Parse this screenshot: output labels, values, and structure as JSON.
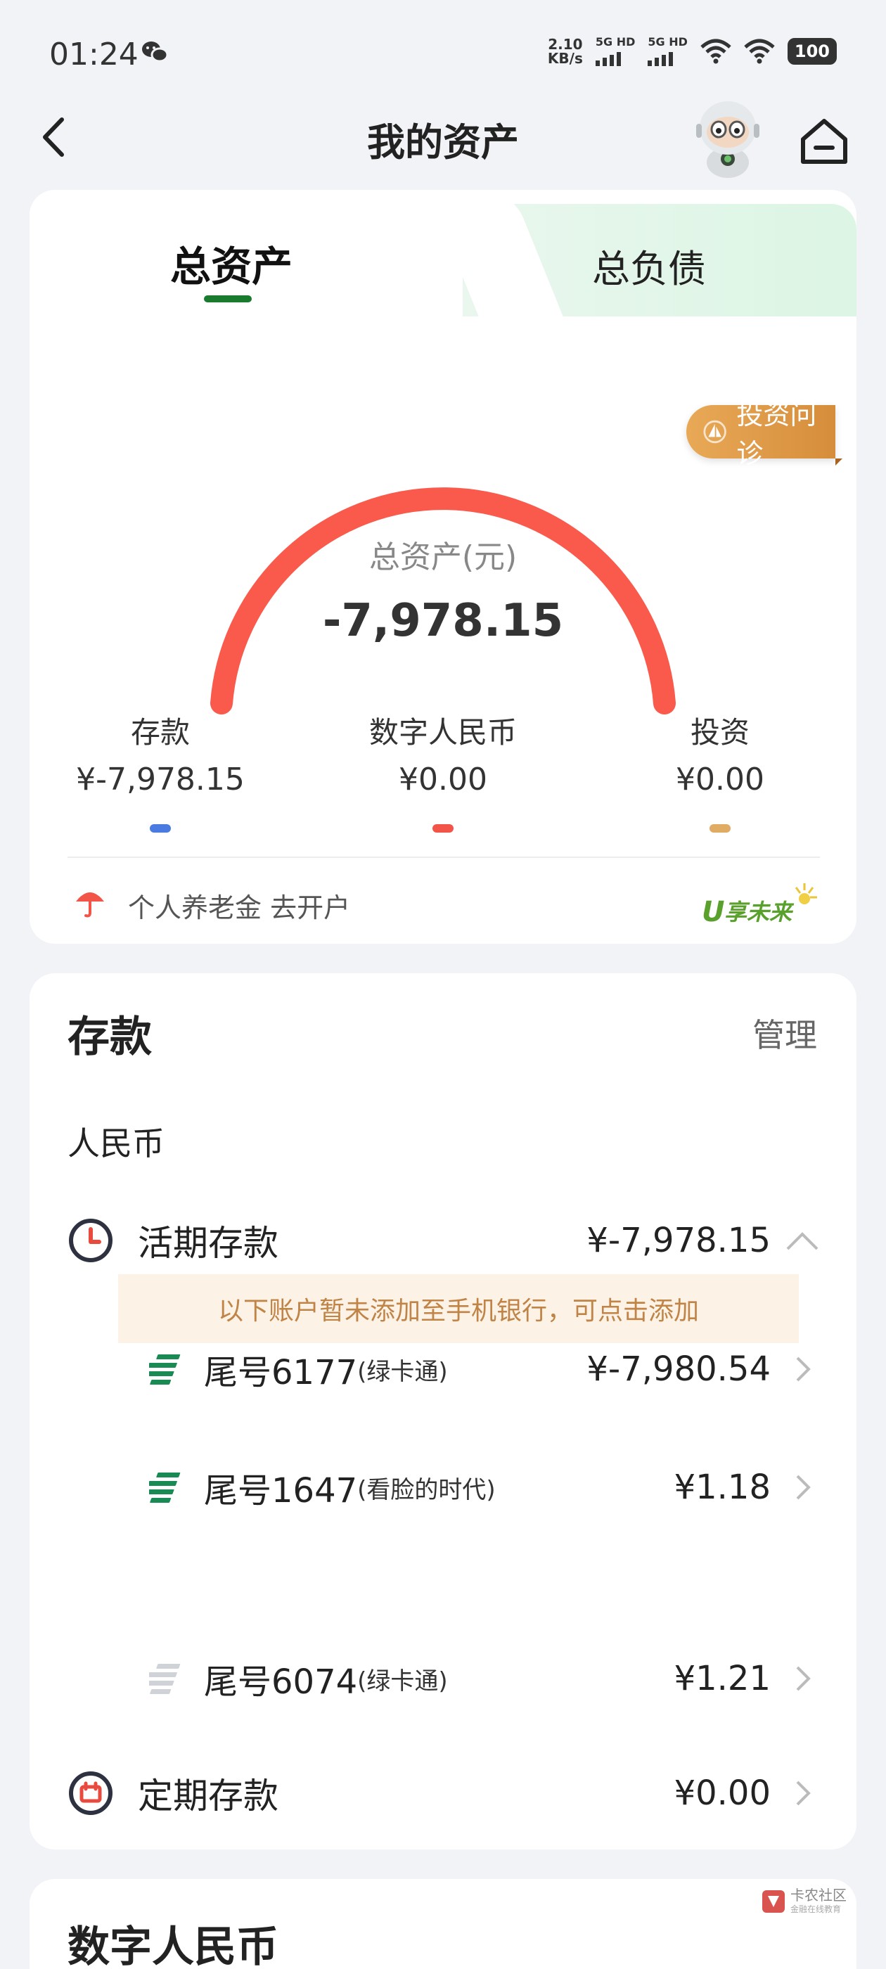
{
  "status_bar": {
    "time": "01:24",
    "net_speed_value": "2.10",
    "net_speed_unit": "KB/s",
    "signal1_label": "5G HD",
    "signal2_label": "5G HD",
    "battery": "100"
  },
  "header": {
    "title": "我的资产"
  },
  "tabs": {
    "assets": "总资产",
    "liabilities": "总负债"
  },
  "invest_badge": "投资问诊",
  "gauge": {
    "label": "总资产(元)",
    "value": "-7,978.15",
    "color": "#fa5a4b"
  },
  "categories": [
    {
      "name": "存款",
      "value": "¥-7,978.15",
      "color": "#4a7be0"
    },
    {
      "name": "数字人民币",
      "value": "¥0.00",
      "color": "#f25448"
    },
    {
      "name": "投资",
      "value": "¥0.00",
      "color": "#e0ab63"
    }
  ],
  "pension_link": "个人养老金 去开户",
  "logo_text": "U享未来",
  "deposit": {
    "title": "存款",
    "manage": "管理",
    "currency": "人民币",
    "demand_label": "活期存款",
    "demand_value": "¥-7,978.15",
    "accounts": [
      {
        "num": "尾号6177",
        "tag": "(绿卡通)",
        "value": "¥-7,980.54"
      },
      {
        "num": "尾号1647",
        "tag": "(看脸的时代)",
        "value": "¥1.18"
      }
    ],
    "notice": "以下账户暂未添加至手机银行，可点击添加",
    "unadded_account": {
      "num": "尾号6074",
      "tag": "(绿卡通)",
      "value": "¥1.21"
    },
    "fixed_label": "定期存款",
    "fixed_value": "¥0.00"
  },
  "digital_rmb": {
    "title": "数字人民币"
  },
  "watermark": {
    "text": "卡农社区",
    "sub": "金融在线教育"
  }
}
